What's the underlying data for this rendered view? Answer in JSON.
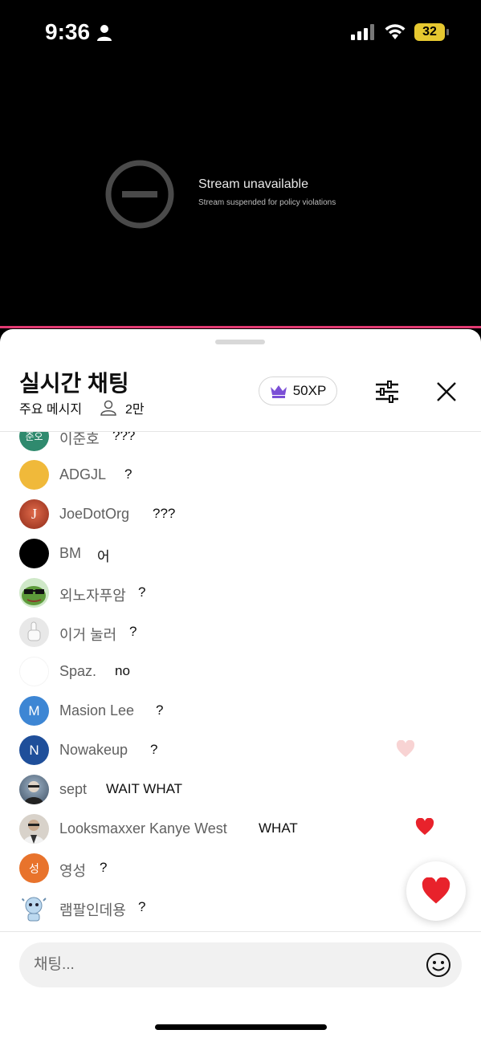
{
  "status_bar": {
    "time": "9:36",
    "battery": "32"
  },
  "video": {
    "title": "Stream unavailable",
    "subtitle": "Stream suspended for policy violations"
  },
  "chat_header": {
    "title": "실시간 채팅",
    "mode": "주요 메시지",
    "viewers": "2만",
    "xp": "50XP"
  },
  "messages": [
    {
      "author": "이준호",
      "text": "???",
      "avatar_letter": "준오",
      "avatar_color": "#2f8a6e"
    },
    {
      "author": "ADGJL",
      "text": "?",
      "avatar_letter": "",
      "avatar_color": "#f0b93a"
    },
    {
      "author": "JoeDotOrg",
      "text": "???",
      "avatar_letter": "J",
      "avatar_color": "#b3432b"
    },
    {
      "author": "BM",
      "text": "어",
      "avatar_letter": "",
      "avatar_color": "#000000"
    },
    {
      "author": "외노자푸암",
      "text": "?",
      "avatar_letter": "",
      "avatar_color": "#5d9a3a"
    },
    {
      "author": "이거 눌러",
      "text": "?",
      "avatar_letter": "",
      "avatar_color": "#e8e8e8"
    },
    {
      "author": "Spaz.",
      "text": "no",
      "avatar_letter": "",
      "avatar_color": "#ffffff"
    },
    {
      "author": "Masion Lee",
      "text": "?",
      "avatar_letter": "M",
      "avatar_color": "#3d86d4"
    },
    {
      "author": "Nowakeup",
      "text": "?",
      "avatar_letter": "N",
      "avatar_color": "#1f4f9a"
    },
    {
      "author": "sept",
      "text": "WAIT WHAT",
      "avatar_letter": "",
      "avatar_color": "#5a6f86"
    },
    {
      "author": "Looksmaxxer Kanye West",
      "text": "WHAT",
      "avatar_letter": "",
      "avatar_color": "#8d8174"
    },
    {
      "author": "영성",
      "text": "?",
      "avatar_letter": "성",
      "avatar_color": "#e8732c"
    },
    {
      "author": "램팔인데용",
      "text": "?",
      "avatar_letter": "",
      "avatar_color": "#cfe3f2"
    }
  ],
  "input": {
    "placeholder": "채팅..."
  },
  "icons": {
    "status": [
      "person-icon",
      "signal-icon",
      "wifi-icon",
      "battery-icon"
    ],
    "header": [
      "crown-icon",
      "person-outline-icon",
      "filter-icon",
      "close-icon"
    ],
    "other": [
      "blocked-icon",
      "heart-icon",
      "smiley-icon"
    ]
  },
  "colors": {
    "accent_pink": "#e23a72",
    "heart_red": "#e8222b",
    "crown_purple": "#7b4fd6"
  }
}
